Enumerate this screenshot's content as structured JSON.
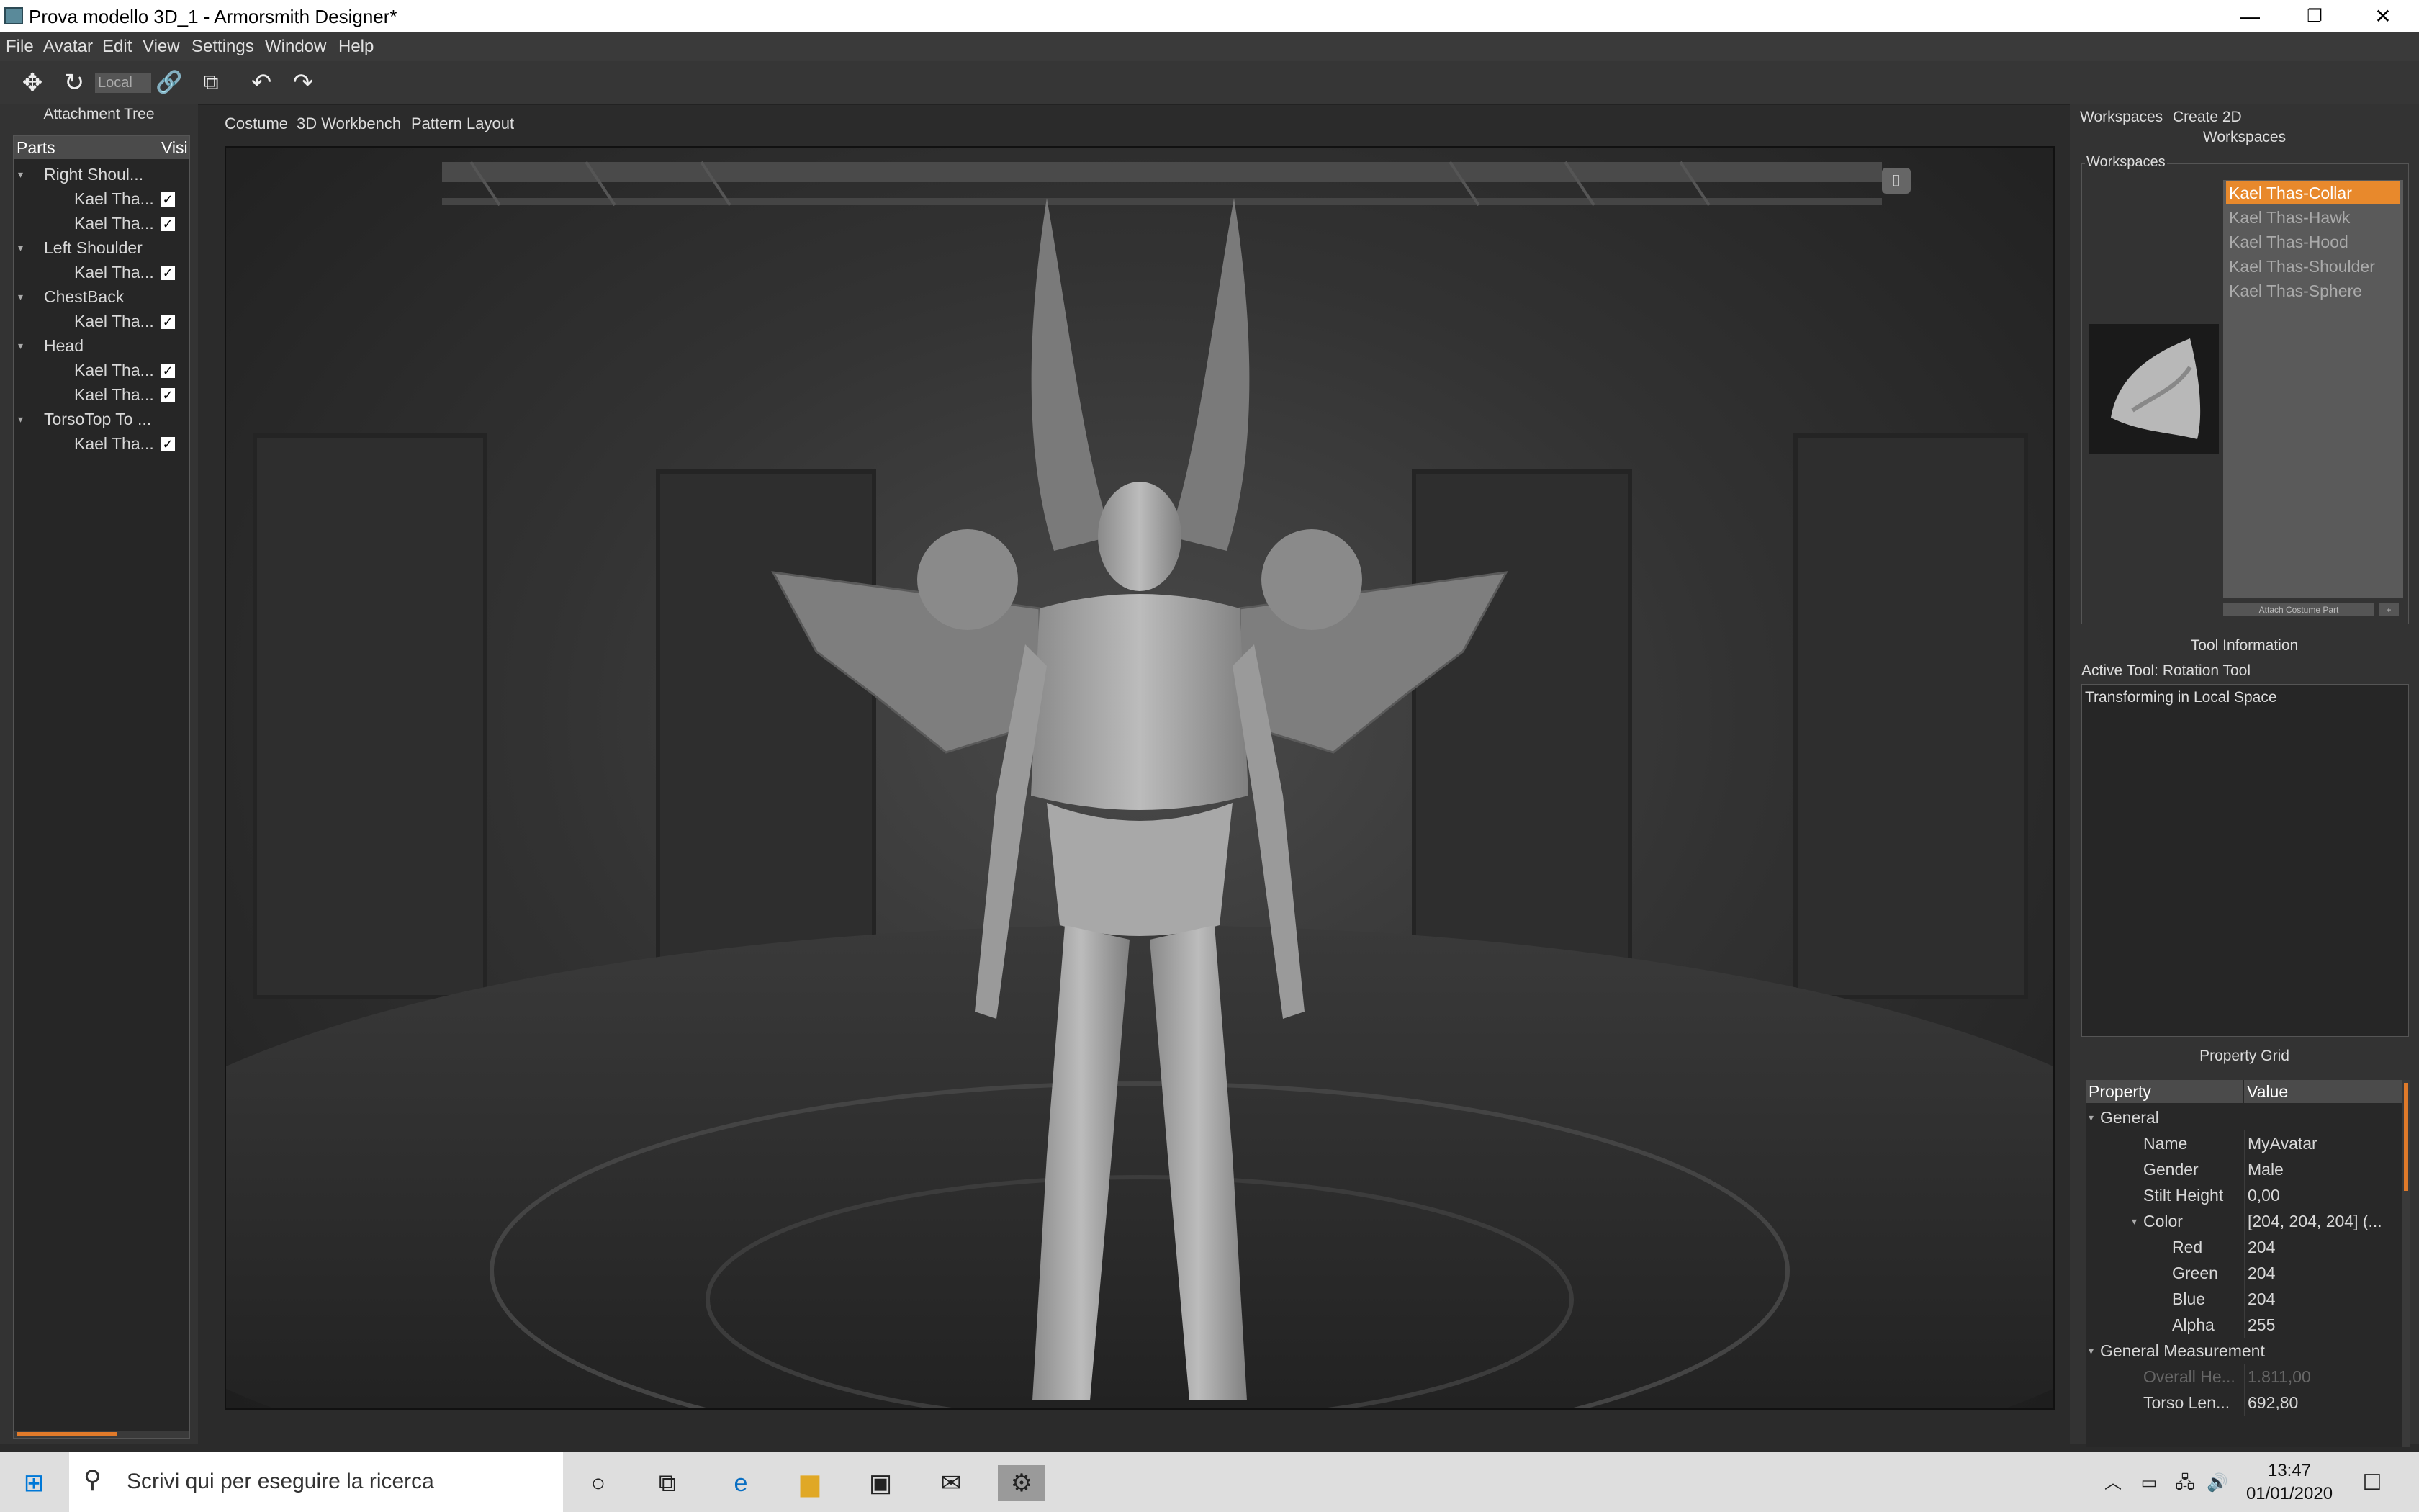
{
  "window": {
    "title": "Prova modello 3D_1 - Armorsmith Designer*",
    "controls": [
      "—",
      "❐",
      "✕"
    ]
  },
  "menu": [
    "File",
    "Avatar",
    "Edit",
    "View",
    "Settings",
    "Window",
    "Help"
  ],
  "toolbar": {
    "coord_space": "Local",
    "icons": [
      "move-icon",
      "rotate-icon",
      "link-icon",
      "external-icon",
      "undo-icon",
      "redo-icon"
    ]
  },
  "attachment_tree": {
    "title": "Attachment Tree",
    "columns": [
      "Parts",
      "Visi"
    ],
    "rows": [
      {
        "label": "Right Shoul...",
        "level": 0
      },
      {
        "label": "Kael Tha...",
        "level": 1,
        "checked": "✓"
      },
      {
        "label": "Kael Tha...",
        "level": 1,
        "checked": "✓"
      },
      {
        "label": "Left Shoulder",
        "level": 0
      },
      {
        "label": "Kael Tha...",
        "level": 1,
        "checked": "✓"
      },
      {
        "label": "ChestBack",
        "level": 0
      },
      {
        "label": "Kael Tha...",
        "level": 1,
        "checked": "✓"
      },
      {
        "label": "Head",
        "level": 0
      },
      {
        "label": "Kael Tha...",
        "level": 1,
        "checked": "✓"
      },
      {
        "label": "Kael Tha...",
        "level": 1,
        "checked": "✓"
      },
      {
        "label": "TorsoTop To ...",
        "level": 0
      },
      {
        "label": "Kael Tha...",
        "level": 1,
        "checked": "✓"
      }
    ]
  },
  "center_tabs": [
    "Costume",
    "3D Workbench",
    "Pattern Layout"
  ],
  "right_panel": {
    "tabs": [
      "Workspaces",
      "Create 2D"
    ],
    "workspaces_title": "Workspaces",
    "workspaces_group": "Workspaces",
    "workspaces": [
      "Kael Thas-Collar",
      "Kael Thas-Hawk",
      "Kael Thas-Hood",
      "Kael Thas-Shoulder",
      "Kael Thas-Sphere"
    ],
    "attach_button": "Attach Costume Part",
    "attach_plus": "+",
    "tool_info_title": "Tool Information",
    "active_tool": "Active Tool: Rotation Tool",
    "tool_info_text": "Transforming in Local Space",
    "property_grid_title": "Property Grid",
    "property_columns": [
      "Property",
      "Value"
    ],
    "properties": [
      {
        "k": "General",
        "v": "",
        "indent": 0,
        "group": true
      },
      {
        "k": "Name",
        "v": "MyAvatar",
        "indent": 1
      },
      {
        "k": "Gender",
        "v": "Male",
        "indent": 1
      },
      {
        "k": "Stilt Height",
        "v": "0,00",
        "indent": 1
      },
      {
        "k": "Color",
        "v": "[204, 204, 204] (...",
        "indent": 1,
        "group": true
      },
      {
        "k": "Red",
        "v": "204",
        "indent": 2
      },
      {
        "k": "Green",
        "v": "204",
        "indent": 2
      },
      {
        "k": "Blue",
        "v": "204",
        "indent": 2
      },
      {
        "k": "Alpha",
        "v": "255",
        "indent": 2
      },
      {
        "k": "General Measurement",
        "v": "",
        "indent": 0,
        "group": true
      },
      {
        "k": "Overall He...",
        "v": "1.811,00",
        "indent": 1,
        "dim": true
      },
      {
        "k": "Torso Len...",
        "v": "692,80",
        "indent": 1
      }
    ]
  },
  "taskbar": {
    "search_placeholder": "Scrivi qui per eseguire la ricerca",
    "time": "13:47",
    "date": "01/01/2020"
  },
  "colors": {
    "accent": "#e8892c",
    "panel": "#333333",
    "viewport": "#3a3a3a"
  }
}
